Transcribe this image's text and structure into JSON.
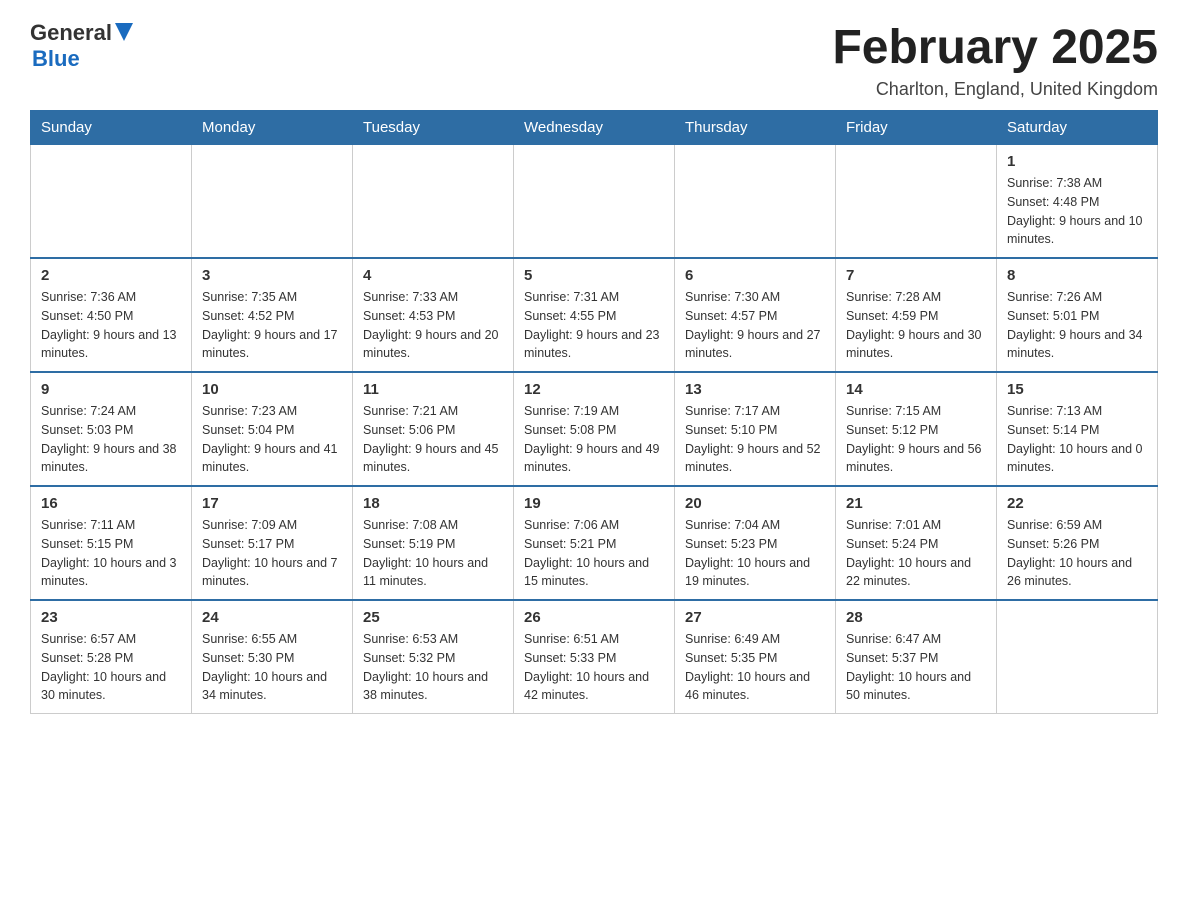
{
  "header": {
    "logo": {
      "line1": "General",
      "line2": "Blue"
    },
    "title": "February 2025",
    "location": "Charlton, England, United Kingdom"
  },
  "days_of_week": [
    "Sunday",
    "Monday",
    "Tuesday",
    "Wednesday",
    "Thursday",
    "Friday",
    "Saturday"
  ],
  "weeks": [
    [
      {
        "day": "",
        "info": ""
      },
      {
        "day": "",
        "info": ""
      },
      {
        "day": "",
        "info": ""
      },
      {
        "day": "",
        "info": ""
      },
      {
        "day": "",
        "info": ""
      },
      {
        "day": "",
        "info": ""
      },
      {
        "day": "1",
        "info": "Sunrise: 7:38 AM\nSunset: 4:48 PM\nDaylight: 9 hours and 10 minutes."
      }
    ],
    [
      {
        "day": "2",
        "info": "Sunrise: 7:36 AM\nSunset: 4:50 PM\nDaylight: 9 hours and 13 minutes."
      },
      {
        "day": "3",
        "info": "Sunrise: 7:35 AM\nSunset: 4:52 PM\nDaylight: 9 hours and 17 minutes."
      },
      {
        "day": "4",
        "info": "Sunrise: 7:33 AM\nSunset: 4:53 PM\nDaylight: 9 hours and 20 minutes."
      },
      {
        "day": "5",
        "info": "Sunrise: 7:31 AM\nSunset: 4:55 PM\nDaylight: 9 hours and 23 minutes."
      },
      {
        "day": "6",
        "info": "Sunrise: 7:30 AM\nSunset: 4:57 PM\nDaylight: 9 hours and 27 minutes."
      },
      {
        "day": "7",
        "info": "Sunrise: 7:28 AM\nSunset: 4:59 PM\nDaylight: 9 hours and 30 minutes."
      },
      {
        "day": "8",
        "info": "Sunrise: 7:26 AM\nSunset: 5:01 PM\nDaylight: 9 hours and 34 minutes."
      }
    ],
    [
      {
        "day": "9",
        "info": "Sunrise: 7:24 AM\nSunset: 5:03 PM\nDaylight: 9 hours and 38 minutes."
      },
      {
        "day": "10",
        "info": "Sunrise: 7:23 AM\nSunset: 5:04 PM\nDaylight: 9 hours and 41 minutes."
      },
      {
        "day": "11",
        "info": "Sunrise: 7:21 AM\nSunset: 5:06 PM\nDaylight: 9 hours and 45 minutes."
      },
      {
        "day": "12",
        "info": "Sunrise: 7:19 AM\nSunset: 5:08 PM\nDaylight: 9 hours and 49 minutes."
      },
      {
        "day": "13",
        "info": "Sunrise: 7:17 AM\nSunset: 5:10 PM\nDaylight: 9 hours and 52 minutes."
      },
      {
        "day": "14",
        "info": "Sunrise: 7:15 AM\nSunset: 5:12 PM\nDaylight: 9 hours and 56 minutes."
      },
      {
        "day": "15",
        "info": "Sunrise: 7:13 AM\nSunset: 5:14 PM\nDaylight: 10 hours and 0 minutes."
      }
    ],
    [
      {
        "day": "16",
        "info": "Sunrise: 7:11 AM\nSunset: 5:15 PM\nDaylight: 10 hours and 3 minutes."
      },
      {
        "day": "17",
        "info": "Sunrise: 7:09 AM\nSunset: 5:17 PM\nDaylight: 10 hours and 7 minutes."
      },
      {
        "day": "18",
        "info": "Sunrise: 7:08 AM\nSunset: 5:19 PM\nDaylight: 10 hours and 11 minutes."
      },
      {
        "day": "19",
        "info": "Sunrise: 7:06 AM\nSunset: 5:21 PM\nDaylight: 10 hours and 15 minutes."
      },
      {
        "day": "20",
        "info": "Sunrise: 7:04 AM\nSunset: 5:23 PM\nDaylight: 10 hours and 19 minutes."
      },
      {
        "day": "21",
        "info": "Sunrise: 7:01 AM\nSunset: 5:24 PM\nDaylight: 10 hours and 22 minutes."
      },
      {
        "day": "22",
        "info": "Sunrise: 6:59 AM\nSunset: 5:26 PM\nDaylight: 10 hours and 26 minutes."
      }
    ],
    [
      {
        "day": "23",
        "info": "Sunrise: 6:57 AM\nSunset: 5:28 PM\nDaylight: 10 hours and 30 minutes."
      },
      {
        "day": "24",
        "info": "Sunrise: 6:55 AM\nSunset: 5:30 PM\nDaylight: 10 hours and 34 minutes."
      },
      {
        "day": "25",
        "info": "Sunrise: 6:53 AM\nSunset: 5:32 PM\nDaylight: 10 hours and 38 minutes."
      },
      {
        "day": "26",
        "info": "Sunrise: 6:51 AM\nSunset: 5:33 PM\nDaylight: 10 hours and 42 minutes."
      },
      {
        "day": "27",
        "info": "Sunrise: 6:49 AM\nSunset: 5:35 PM\nDaylight: 10 hours and 46 minutes."
      },
      {
        "day": "28",
        "info": "Sunrise: 6:47 AM\nSunset: 5:37 PM\nDaylight: 10 hours and 50 minutes."
      },
      {
        "day": "",
        "info": ""
      }
    ]
  ]
}
